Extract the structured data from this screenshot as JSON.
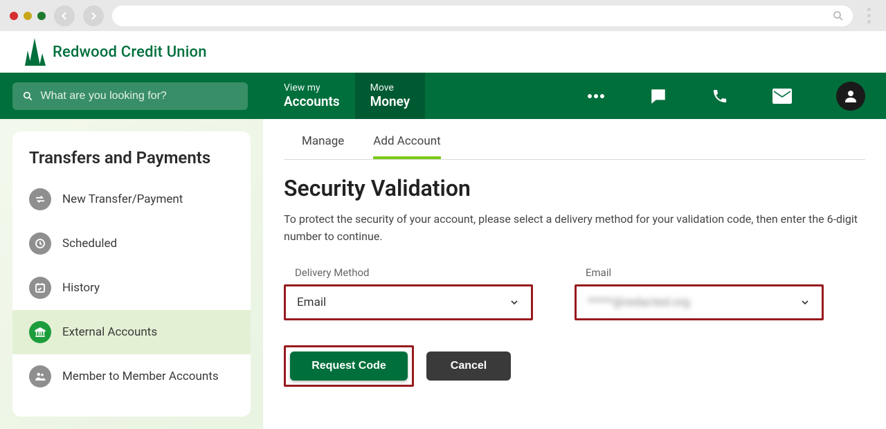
{
  "brand": {
    "name": "Redwood Credit Union"
  },
  "nav": {
    "search_placeholder": "What are you looking for?",
    "tabs": [
      {
        "small": "View my",
        "big": "Accounts"
      },
      {
        "small": "Move",
        "big": "Money"
      }
    ]
  },
  "sidebar": {
    "title": "Transfers and Payments",
    "items": [
      {
        "label": "New Transfer/Payment"
      },
      {
        "label": "Scheduled"
      },
      {
        "label": "History"
      },
      {
        "label": "External Accounts"
      },
      {
        "label": "Member to Member Accounts"
      }
    ]
  },
  "subtabs": {
    "manage": "Manage",
    "add": "Add Account"
  },
  "page": {
    "title": "Security Validation",
    "description": "To protect the security of your account, please select a delivery method for your validation code, then enter the 6-digit number to continue."
  },
  "form": {
    "delivery_label": "Delivery Method",
    "delivery_value": "Email",
    "email_label": "Email",
    "email_value": "*****@redacted.org"
  },
  "buttons": {
    "request": "Request Code",
    "cancel": "Cancel"
  }
}
